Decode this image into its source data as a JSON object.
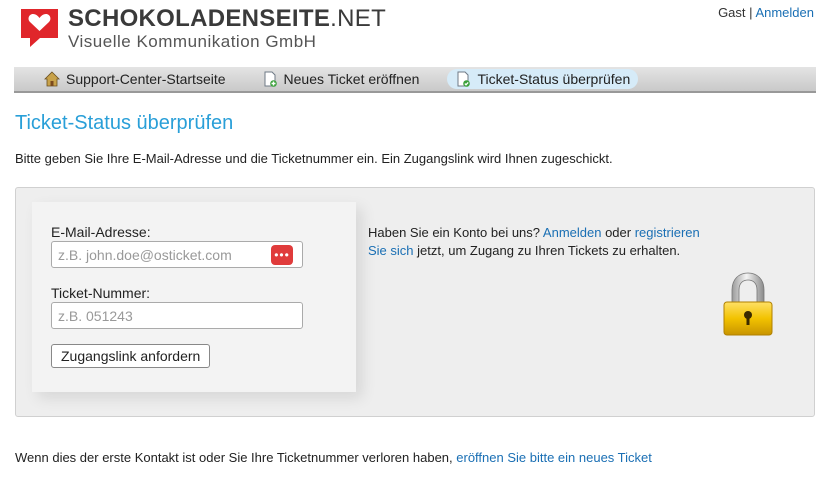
{
  "header": {
    "brand_bold": "SCHOKOLADENSEITE",
    "brand_rest": ".NET",
    "subtitle": "Visuelle Kommunikation GmbH",
    "user": "Gast",
    "separator": "|",
    "login_link": "Anmelden"
  },
  "nav": {
    "items": [
      {
        "label": "Support-Center-Startseite",
        "icon": "home-icon"
      },
      {
        "label": "Neues Ticket eröffnen",
        "icon": "new-ticket-icon"
      },
      {
        "label": "Ticket-Status überprüfen",
        "icon": "ticket-status-icon",
        "active": true
      }
    ]
  },
  "page": {
    "title": "Ticket-Status überprüfen",
    "intro": "Bitte geben Sie Ihre E-Mail-Adresse und die Ticketnummer ein. Ein Zugangslink wird Ihnen zugeschickt."
  },
  "form": {
    "email_label": "E-Mail-Adresse:",
    "email_placeholder": "z.B. john.doe@osticket.com",
    "email_value": "",
    "ticket_label": "Ticket-Nummer:",
    "ticket_placeholder": "z.B. 051243",
    "ticket_value": "",
    "submit_label": "Zugangslink anfordern",
    "password_badge": "•••"
  },
  "info": {
    "text_1": "Haben Sie ein Konto bei uns? ",
    "login_link": "Anmelden",
    "text_2": " oder ",
    "register_link": "registrieren Sie sich",
    "text_3": " jetzt, um Zugang zu Ihren Tickets zu erhalten."
  },
  "footer": {
    "text": "Wenn dies der erste Kontakt ist oder Sie Ihre Ticketnummer verloren haben, ",
    "link": "eröffnen Sie bitte ein neues Ticket"
  },
  "colors": {
    "accent": "#299fd8",
    "link": "#1a6fb4",
    "logo_red": "#e0262b",
    "lock_gold": "#f2c200"
  }
}
